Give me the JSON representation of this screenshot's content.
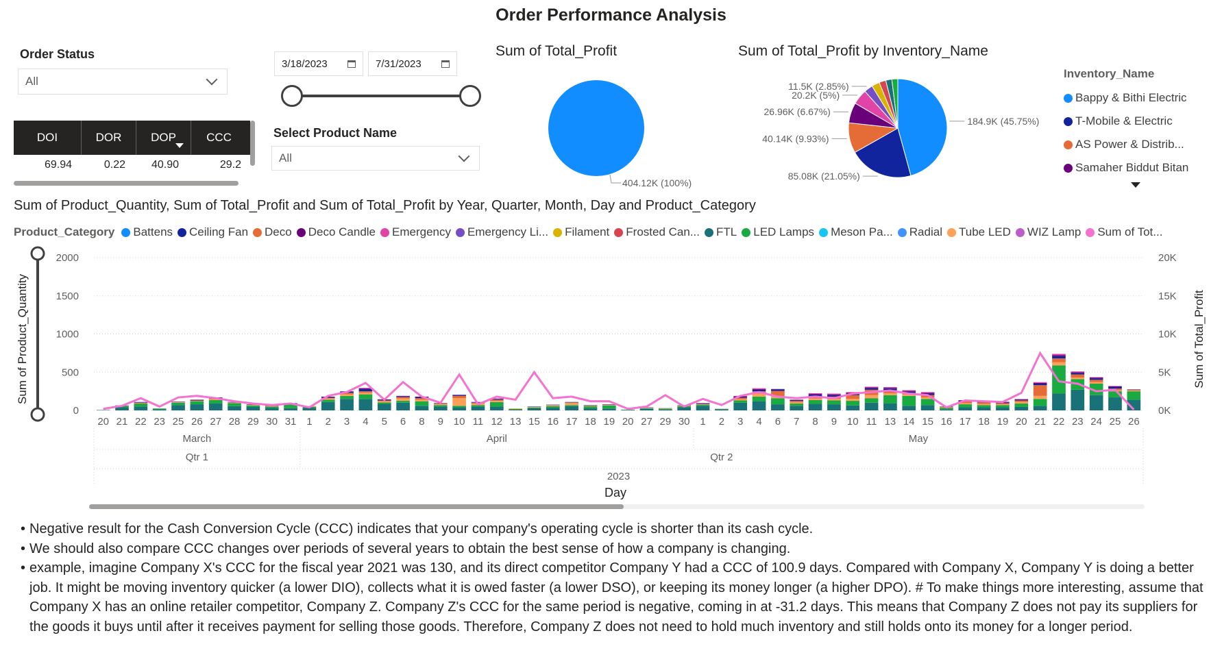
{
  "page": {
    "title": "Order Performance Analysis"
  },
  "order_status": {
    "label": "Order Status",
    "selected": "All"
  },
  "date_range": {
    "start": "3/18/2023",
    "end": "7/31/2023"
  },
  "product_name": {
    "label": "Select Product Name",
    "selected": "All"
  },
  "metrics_table": {
    "columns": [
      "DOI",
      "DOR",
      "DOP",
      "CCC"
    ],
    "row": [
      "69.94",
      "0.22",
      "40.90",
      "29.2"
    ]
  },
  "profit_pie": {
    "title": "Sum of Total_Profit",
    "label": "404.12K (100%)",
    "color": "#118DFF"
  },
  "inventory_pie": {
    "title": "Sum of Total_Profit by Inventory_Name",
    "legend_title": "Inventory_Name",
    "legend": [
      {
        "name": "Bappy & Bithi Electric",
        "color": "#118DFF"
      },
      {
        "name": "T-Mobile & Electric",
        "color": "#12239E"
      },
      {
        "name": "AS Power & Distrib...",
        "color": "#E66C37"
      },
      {
        "name": "Samaher Biddut Bitan",
        "color": "#6B007B"
      }
    ],
    "slices": [
      {
        "value": 45.75,
        "label": "184.9K (45.75%)",
        "color": "#118DFF"
      },
      {
        "value": 21.05,
        "label": "85.08K (21.05%)",
        "color": "#12239E"
      },
      {
        "value": 9.93,
        "label": "40.14K (9.93%)",
        "color": "#E66C37"
      },
      {
        "value": 6.67,
        "label": "26.96K (6.67%)",
        "color": "#6B007B"
      },
      {
        "value": 5,
        "label": "20.2K (5%)",
        "color": "#E044A7"
      },
      {
        "value": 2.85,
        "label": "11.5K (2.85%)",
        "color": "#744EC2"
      },
      {
        "value": 2.6,
        "label": "",
        "color": "#D9B300"
      },
      {
        "value": 2.2,
        "label": "",
        "color": "#D64550"
      },
      {
        "value": 2.0,
        "label": "",
        "color": "#197278"
      },
      {
        "value": 1.95,
        "label": "",
        "color": "#1AAB40"
      }
    ]
  },
  "combo": {
    "title": "Sum of Product_Quantity, Sum of Total_Profit and Sum of Total_Profit by Year, Quarter, Month, Day and Product_Category",
    "legend_title": "Product_Category",
    "legend": [
      {
        "name": "Battens",
        "color": "#118DFF"
      },
      {
        "name": "Ceiling Fan",
        "color": "#12239E"
      },
      {
        "name": "Deco",
        "color": "#E66C37"
      },
      {
        "name": "Deco Candle",
        "color": "#6B007B"
      },
      {
        "name": "Emergency",
        "color": "#E044A7"
      },
      {
        "name": "Emergency Li...",
        "color": "#744EC2"
      },
      {
        "name": "Filament",
        "color": "#D9B300"
      },
      {
        "name": "Frosted Can...",
        "color": "#D64550"
      },
      {
        "name": "FTL",
        "color": "#197278"
      },
      {
        "name": "LED Lamps",
        "color": "#1AAB40"
      },
      {
        "name": "Meson Pa...",
        "color": "#15C6F4"
      },
      {
        "name": "Radial",
        "color": "#4092FF"
      },
      {
        "name": "Tube LED",
        "color": "#FFA058"
      },
      {
        "name": "WIZ Lamp",
        "color": "#BE5DC9"
      },
      {
        "name": "Sum of Tot...",
        "color": "#F472D0"
      }
    ],
    "y_left_label": "Sum of Product_Quantity",
    "y_right_label": "Sum of Total_Profit",
    "y_left_ticks": [
      "2000",
      "1500",
      "1000",
      "500",
      "0"
    ],
    "y_right_ticks": [
      "20K",
      "15K",
      "10K",
      "5K",
      "0K"
    ],
    "x_label": "Day",
    "months": [
      "March",
      "April",
      "May"
    ],
    "quarters": [
      "Qtr 1",
      "Qtr 2"
    ],
    "year": "2023"
  },
  "chart_data": {
    "type": "bar",
    "x": [
      "20",
      "21",
      "22",
      "23",
      "25",
      "26",
      "27",
      "28",
      "29",
      "30",
      "31",
      "1",
      "2",
      "3",
      "4",
      "5",
      "6",
      "8",
      "9",
      "10",
      "11",
      "12",
      "13",
      "15",
      "16",
      "17",
      "18",
      "19",
      "20",
      "27",
      "29",
      "30",
      "1",
      "2",
      "3",
      "4",
      "6",
      "7",
      "8",
      "9",
      "10",
      "11",
      "13",
      "14",
      "15",
      "16",
      "17",
      "18",
      "19",
      "20",
      "21",
      "22",
      "23",
      "24",
      "25",
      "26"
    ],
    "ylim": [
      0,
      2000
    ],
    "y2lim": [
      0,
      20000
    ],
    "series": [
      {
        "name": "FTL",
        "values": [
          5,
          40,
          50,
          15,
          70,
          80,
          90,
          55,
          45,
          35,
          30,
          35,
          110,
          150,
          150,
          85,
          100,
          60,
          50,
          40,
          50,
          50,
          8,
          30,
          35,
          55,
          30,
          25,
          5,
          20,
          12,
          40,
          60,
          15,
          100,
          120,
          80,
          60,
          85,
          80,
          65,
          100,
          90,
          60,
          70,
          15,
          40,
          40,
          40,
          45,
          60,
          220,
          270,
          200,
          170,
          140
        ]
      },
      {
        "name": "LED Lamps",
        "values": [
          0,
          15,
          40,
          10,
          30,
          40,
          45,
          40,
          20,
          15,
          50,
          10,
          30,
          40,
          60,
          20,
          25,
          60,
          20,
          20,
          20,
          60,
          10,
          8,
          20,
          15,
          25,
          40,
          5,
          10,
          10,
          15,
          15,
          5,
          30,
          60,
          80,
          30,
          50,
          50,
          60,
          60,
          110,
          130,
          80,
          20,
          40,
          30,
          30,
          45,
          90,
          370,
          140,
          150,
          80,
          110
        ]
      },
      {
        "name": "Tube LED",
        "values": [
          0,
          0,
          5,
          0,
          5,
          5,
          10,
          5,
          5,
          5,
          5,
          5,
          15,
          20,
          20,
          15,
          30,
          20,
          10,
          100,
          20,
          15,
          5,
          5,
          10,
          25,
          5,
          5,
          0,
          5,
          3,
          5,
          5,
          0,
          15,
          40,
          25,
          15,
          20,
          20,
          25,
          40,
          25,
          20,
          20,
          5,
          15,
          15,
          10,
          20,
          40,
          40,
          20,
          20,
          15,
          10
        ]
      },
      {
        "name": "Deco",
        "values": [
          0,
          5,
          5,
          0,
          5,
          5,
          10,
          5,
          5,
          5,
          5,
          5,
          10,
          20,
          20,
          10,
          20,
          20,
          10,
          30,
          10,
          15,
          2,
          3,
          5,
          10,
          5,
          5,
          0,
          3,
          2,
          3,
          5,
          2,
          20,
          30,
          70,
          20,
          30,
          30,
          50,
          70,
          40,
          20,
          30,
          5,
          20,
          20,
          15,
          20,
          140,
          50,
          40,
          30,
          20,
          10
        ]
      },
      {
        "name": "Ceiling Fan",
        "values": [
          0,
          5,
          5,
          0,
          5,
          5,
          10,
          5,
          5,
          5,
          5,
          0,
          10,
          15,
          30,
          10,
          10,
          15,
          5,
          10,
          5,
          10,
          0,
          5,
          5,
          5,
          5,
          5,
          0,
          3,
          2,
          5,
          5,
          0,
          10,
          20,
          20,
          10,
          20,
          20,
          20,
          20,
          20,
          15,
          20,
          5,
          10,
          10,
          10,
          10,
          20,
          30,
          20,
          20,
          20,
          5
        ]
      },
      {
        "name": "Deco Candle",
        "values": [
          0,
          0,
          5,
          0,
          0,
          5,
          5,
          0,
          0,
          0,
          0,
          0,
          5,
          5,
          10,
          5,
          5,
          5,
          0,
          5,
          5,
          5,
          0,
          0,
          0,
          0,
          0,
          0,
          0,
          0,
          0,
          0,
          5,
          0,
          10,
          10,
          5,
          5,
          10,
          10,
          10,
          10,
          10,
          10,
          10,
          0,
          5,
          5,
          5,
          5,
          10,
          15,
          10,
          10,
          10,
          0
        ]
      },
      {
        "name": "Emergency",
        "values": [
          0,
          0,
          0,
          0,
          0,
          0,
          0,
          0,
          0,
          0,
          0,
          0,
          0,
          0,
          5,
          0,
          0,
          0,
          0,
          0,
          0,
          0,
          0,
          0,
          0,
          0,
          0,
          0,
          0,
          0,
          0,
          0,
          0,
          0,
          5,
          10,
          0,
          0,
          10,
          10,
          10,
          10,
          10,
          10,
          10,
          0,
          5,
          5,
          5,
          5,
          10,
          15,
          10,
          5,
          5,
          0
        ]
      },
      {
        "name": "Sum of Total_Profit",
        "values": [
          200,
          600,
          1600,
          500,
          1700,
          1900,
          1600,
          1200,
          900,
          700,
          900,
          400,
          1900,
          2400,
          3600,
          1400,
          3700,
          1800,
          1000,
          4700,
          800,
          1800,
          1400,
          5000,
          1600,
          1800,
          1200,
          1200,
          200,
          500,
          2000,
          500,
          1500,
          700,
          1900,
          2400,
          1800,
          1600,
          1800,
          1600,
          2200,
          2400,
          2600,
          2200,
          2000,
          400,
          1300,
          1200,
          1100,
          2300,
          7500,
          3800,
          3500,
          2500,
          2700,
          100
        ]
      }
    ],
    "bar_colors": [
      "#197278",
      "#1AAB40",
      "#FFA058",
      "#E66C37",
      "#12239E",
      "#6B007B",
      "#E044A7"
    ],
    "line_color": "#F472D0"
  },
  "notes": [
    "Negative result for the Cash Conversion Cycle (CCC) indicates that your company's operating cycle is shorter than its cash cycle.",
    "We should also compare CCC changes over periods of several years to obtain the best sense of how a company is changing.",
    "example, imagine Company X's CCC for the fiscal year 2021 was 130, and its direct competitor Company Y had a CCC of 100.9 days. Compared with Company X, Company Y is doing a better job. It might be moving inventory quicker (a lower DIO), collects what it is owed faster (a lower DSO), or keeping its money longer (a higher DPO).  # To make things more interesting, assume that Company X has an online retailer competitor, Company Z. Company Z's CCC for the same period is negative, coming in at -31.2 days. This means that Company Z does not pay its suppliers for the goods it buys until after it receives payment for selling those goods. Therefore, Company Z does not need to hold much inventory and still holds onto its money for a longer period."
  ]
}
